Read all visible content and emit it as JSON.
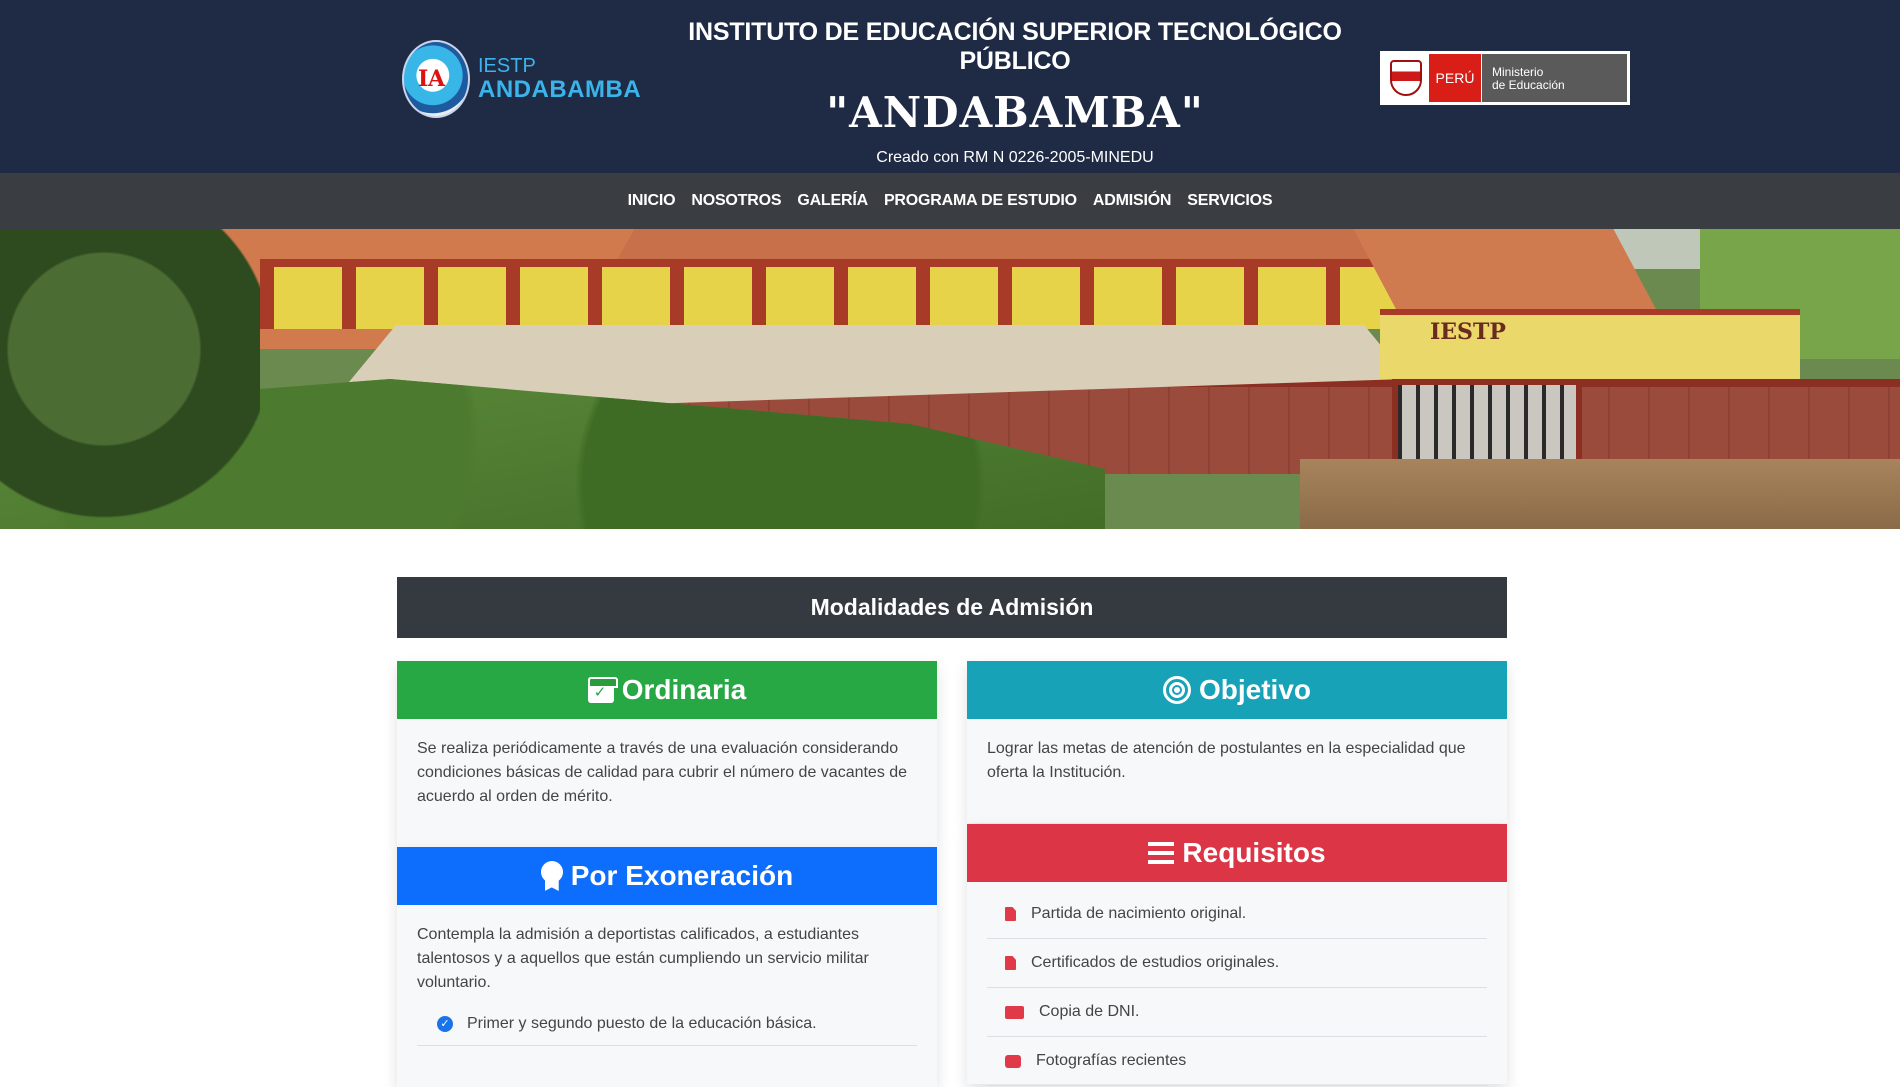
{
  "header": {
    "logo_line1": "IESTP",
    "logo_line2": "ANDABAMBA",
    "institution": "INSTITUTO DE EDUCACIÓN SUPERIOR TECNOLÓGICO PÚBLICO",
    "name": "\"ANDABAMBA\"",
    "created": "Creado con RM N 0226-2005-MINEDU",
    "minedu_country": "PERÚ",
    "minedu_line1": "Ministerio",
    "minedu_line2": "de Educación"
  },
  "nav": {
    "items": [
      {
        "label": "INICIO"
      },
      {
        "label": "NOSOTROS"
      },
      {
        "label": "GALERÍA"
      },
      {
        "label": "PROGRAMA DE ESTUDIO"
      },
      {
        "label": "ADMISIÓN"
      },
      {
        "label": "SERVICIOS"
      }
    ]
  },
  "hero": {
    "sign_text": "IESTP"
  },
  "main": {
    "title": "Modalidades de Admisión",
    "ordinaria": {
      "title": "Ordinaria",
      "icon": "calendar-check-icon",
      "color": "#28a745",
      "text": "Se realiza periódicamente a través de una evaluación considerando condiciones básicas de calidad para cubrir el número de vacantes de acuerdo al orden de mérito."
    },
    "objetivo": {
      "title": "Objetivo",
      "icon": "target-icon",
      "color": "#17a2b8",
      "text": "Lograr las metas de atención de postulantes en la especialidad que oferta la Institución."
    },
    "exoneracion": {
      "title": "Por Exoneración",
      "icon": "award-icon",
      "color": "#0d6efd",
      "text": "Contempla la admisión a deportistas calificados, a estudiantes talentosos y a aquellos que están cumpliendo un servicio militar voluntario.",
      "items": [
        {
          "label": "Primer y segundo puesto de la educación básica."
        }
      ]
    },
    "requisitos": {
      "title": "Requisitos",
      "icon": "list-icon",
      "color": "#dc3545",
      "items": [
        {
          "label": "Partida de nacimiento original.",
          "icon": "file-pdf-icon"
        },
        {
          "label": "Certificados de estudios originales.",
          "icon": "file-pdf-icon"
        },
        {
          "label": "Copia de DNI.",
          "icon": "id-card-icon"
        },
        {
          "label": "Fotografías recientes",
          "icon": "camera-icon"
        }
      ]
    }
  }
}
